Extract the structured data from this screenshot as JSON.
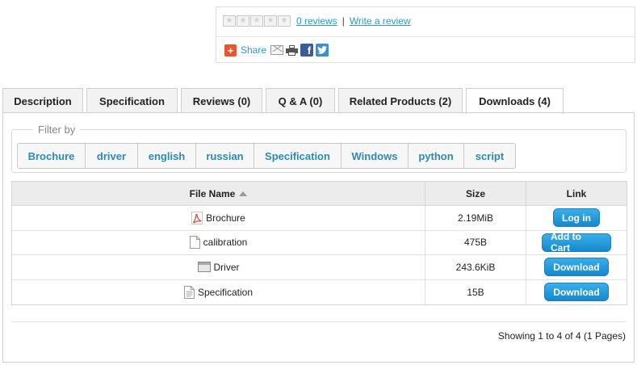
{
  "rating": {
    "stars": 5,
    "reviews_link": "0 reviews",
    "separator": "|",
    "write_review": "Write a review"
  },
  "share": {
    "label": "Share",
    "icons": [
      "plus-icon",
      "mail-icon",
      "print-icon",
      "facebook-icon",
      "twitter-icon"
    ]
  },
  "tabs": [
    {
      "label": "Description",
      "active": false
    },
    {
      "label": "Specification",
      "active": false
    },
    {
      "label": "Reviews (0)",
      "active": false
    },
    {
      "label": "Q & A (0)",
      "active": false
    },
    {
      "label": "Related Products (2)",
      "active": false
    },
    {
      "label": "Downloads (4)",
      "active": true
    }
  ],
  "filter": {
    "legend": "Filter by",
    "buttons": [
      "Brochure",
      "driver",
      "english",
      "russian",
      "Specification",
      "Windows",
      "python",
      "script"
    ]
  },
  "table": {
    "headers": {
      "name": "File Name",
      "size": "Size",
      "link": "Link"
    },
    "rows": [
      {
        "icon": "pdf-icon",
        "name": "Brochure",
        "size": "2.19MiB",
        "action": "Log in"
      },
      {
        "icon": "blank-file-icon",
        "name": "calibration",
        "size": "475B",
        "action": "Add to Cart"
      },
      {
        "icon": "window-icon",
        "name": "Driver",
        "size": "243.6KiB",
        "action": "Download"
      },
      {
        "icon": "text-file-icon",
        "name": "Specification",
        "size": "15B",
        "action": "Download"
      }
    ]
  },
  "pagination": {
    "summary": "Showing 1 to 4 of 4 (1 Pages)"
  },
  "colors": {
    "link": "#2a9bc8",
    "button": "#1f95d8",
    "share_plus": "#e8552f"
  }
}
